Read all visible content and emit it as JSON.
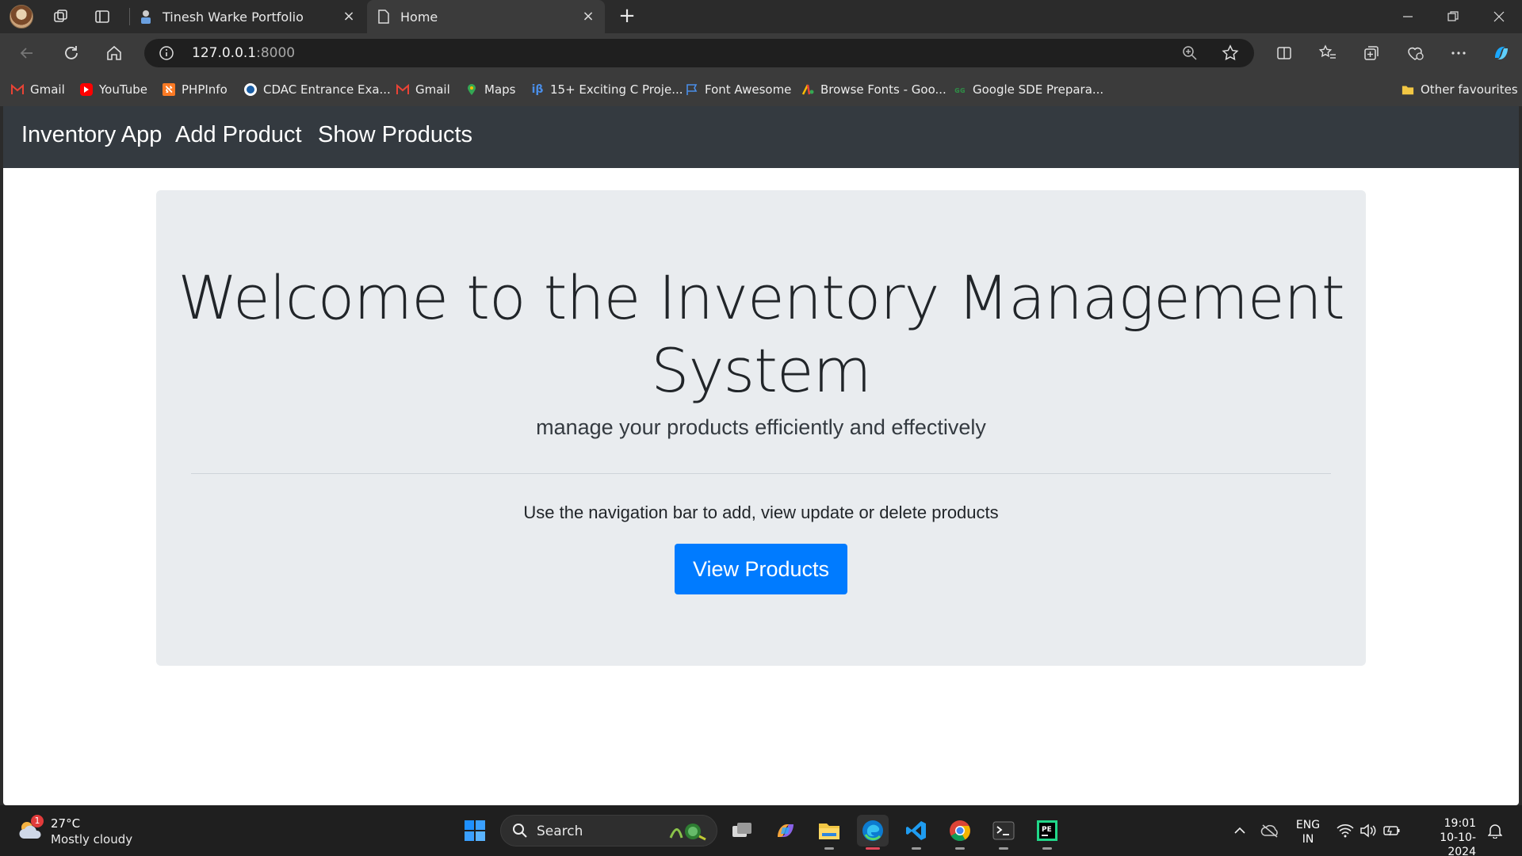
{
  "browser": {
    "tabs": [
      {
        "title": "Tinesh Warke Portfolio",
        "active": false
      },
      {
        "title": "Home",
        "active": true
      }
    ],
    "address": {
      "host": "127.0.0.1",
      "port": ":8000"
    },
    "bookmarks": [
      {
        "label": "Gmail",
        "icon": "gmail-icon"
      },
      {
        "label": "YouTube",
        "icon": "youtube-icon"
      },
      {
        "label": "PHPInfo",
        "icon": "xampp-icon"
      },
      {
        "label": "CDAC Entrance Exa...",
        "icon": "cdac-icon"
      },
      {
        "label": "Gmail",
        "icon": "gmail-icon"
      },
      {
        "label": "Maps",
        "icon": "maps-icon"
      },
      {
        "label": "15+ Exciting C Proje...",
        "icon": "interviewbit-icon"
      },
      {
        "label": "Font Awesome",
        "icon": "flag-icon"
      },
      {
        "label": "Browse Fonts - Goo...",
        "icon": "google-fonts-icon"
      },
      {
        "label": "Google SDE Prepara...",
        "icon": "gfg-icon"
      }
    ],
    "other_favourites": "Other favourites"
  },
  "app": {
    "brand": "Inventory App",
    "nav": [
      "Add Product",
      "Show Products"
    ],
    "jumbotron": {
      "title_line1": "Welcome to the Inventory Management",
      "title_line2": "System",
      "lead": "manage your products efficiently and effectively",
      "body": "Use the navigation bar to add, view update or delete products",
      "button": "View Products"
    },
    "colors": {
      "navbar": "#343a40",
      "jumbotron": "#e9ecef",
      "primary": "#007bff"
    }
  },
  "taskbar": {
    "weather": {
      "temp": "27°C",
      "condition": "Mostly cloudy",
      "badge": "1"
    },
    "search_label": "Search",
    "lang": {
      "line1": "ENG",
      "line2": "IN"
    },
    "time": "19:01",
    "date": "10-10-2024"
  }
}
